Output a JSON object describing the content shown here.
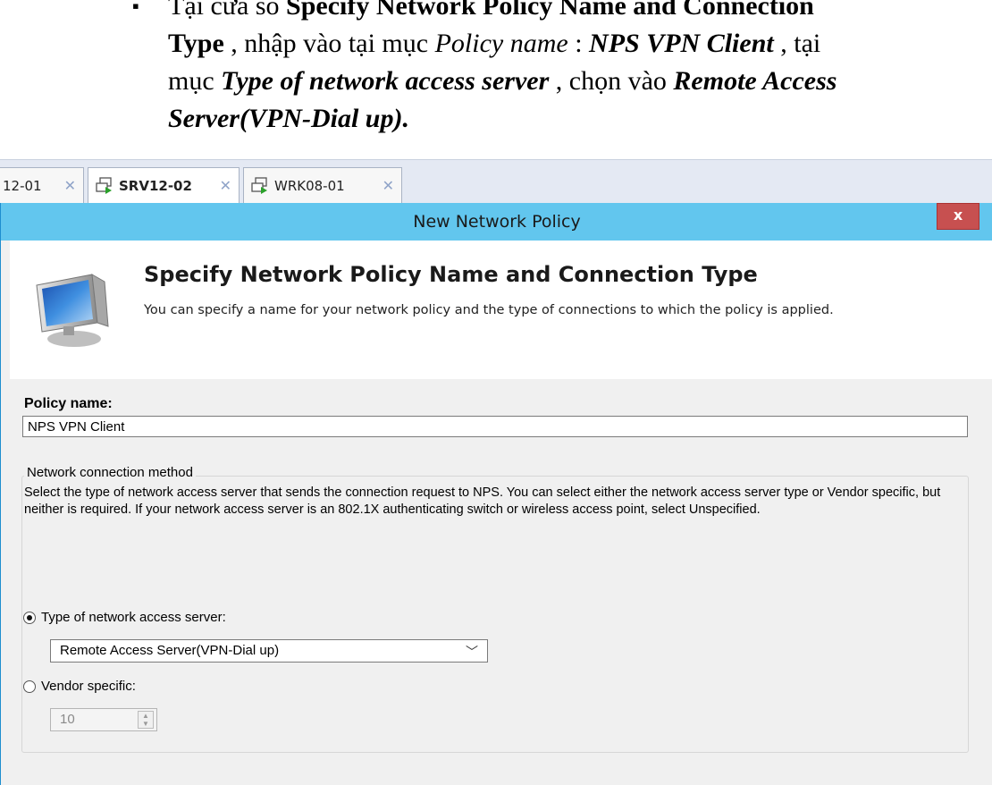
{
  "doc": {
    "bullet": "▪",
    "line1_prefix": "Tại cửa sổ ",
    "line1_bold": "Specify Network Policy Name and Connection",
    "line2_bold": "Type",
    "line2_mid": " , nhập vào tại mục ",
    "line2_italic": "Policy name",
    "line2_colon": " : ",
    "line2_bolditalic": "NPS VPN Client",
    "line2_end": " , tại",
    "line3_start": "mục ",
    "line3_bolditalic": "Type of network access server",
    "line3_mid": " , chọn vào ",
    "line3_bolditalic2": "Remote Access",
    "line4_bolditalic": "Server(VPN-Dial up)."
  },
  "tabs": [
    {
      "label": "12-01",
      "active": false
    },
    {
      "label": "SRV12-02",
      "active": true
    },
    {
      "label": "WRK08-01",
      "active": false
    }
  ],
  "dialog": {
    "title": "New Network Policy",
    "close": "x",
    "header_title": "Specify Network Policy Name and Connection Type",
    "header_subtitle": "You can specify a name for your network policy and the type of connections to which the policy is applied.",
    "policy_name_label": "Policy name:",
    "policy_name_value": "NPS VPN Client",
    "group_label": "Network connection method",
    "group_desc": "Select the type of network access server that sends the connection request to NPS. You can select either the network access server type or Vendor specific, but neither is required.  If your network access server is an 802.1X authenticating switch or wireless access point, select Unspecified.",
    "radio_type_label": "Type of network access server:",
    "radio_type_checked": true,
    "select_value": "Remote Access Server(VPN-Dial up)",
    "radio_vendor_label": "Vendor specific:",
    "radio_vendor_checked": false,
    "vendor_value": "10"
  }
}
